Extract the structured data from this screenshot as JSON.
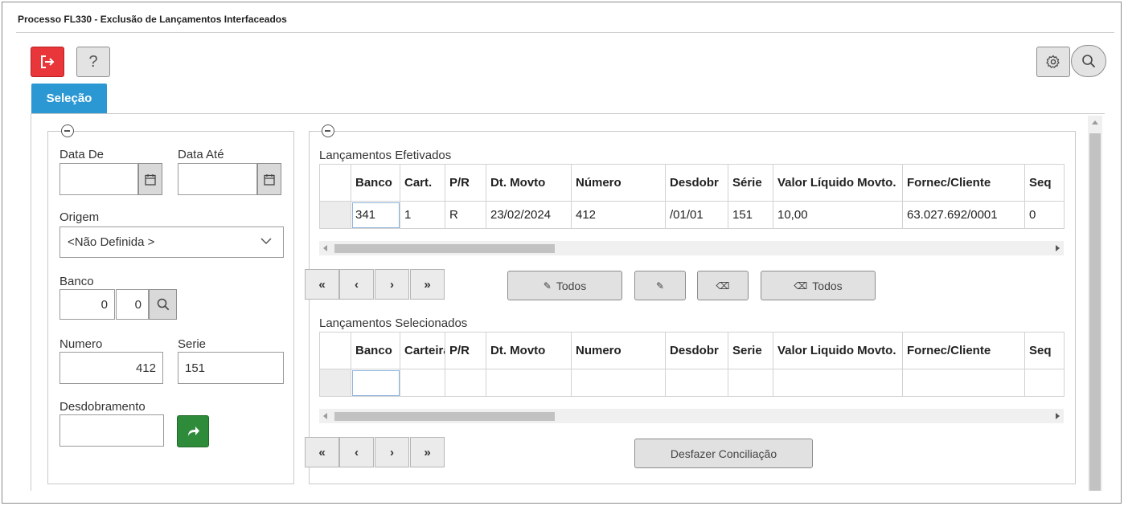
{
  "window": {
    "title": "Processo FL330 - Exclusão de Lançamentos Interfaceados"
  },
  "toolbar": {
    "help_label": "?"
  },
  "tabs": [
    {
      "label": "Seleção",
      "active": true
    }
  ],
  "colors": {
    "exit": "#e8363a",
    "tab_active": "#2b98d4",
    "go": "#2e8b3a"
  },
  "filters": {
    "data_de_label": "Data De",
    "data_de_value": "",
    "data_ate_label": "Data Até",
    "data_ate_value": "",
    "origem_label": "Origem",
    "origem_value": "<Não Definida >",
    "banco_label": "Banco",
    "banco_value1": "0",
    "banco_value2": "0",
    "numero_label": "Numero",
    "numero_value": "412",
    "serie_label": "Serie",
    "serie_value": "151",
    "desdobramento_label": "Desdobramento",
    "desdobramento_value": ""
  },
  "efetivados": {
    "title": "Lançamentos Efetivados",
    "columns": [
      "Banco",
      "Cart.",
      "P/R",
      "Dt. Movto",
      "Número",
      "Desdobr",
      "Série",
      "Valor Líquido Movto.",
      "Fornec/Cliente",
      "Seq"
    ],
    "rows": [
      [
        "341",
        "1",
        "R",
        "23/02/2024",
        "412",
        "/01/01",
        "151",
        "10,00",
        "63.027.692/0001",
        "0"
      ]
    ]
  },
  "nav": {
    "first": "«",
    "prev": "‹",
    "next": "›",
    "last": "»"
  },
  "actions": {
    "mark_all": "Todos",
    "unmark_all": "Todos"
  },
  "selecionados": {
    "title": "Lançamentos Selecionados",
    "columns": [
      "Banco",
      "Carteira",
      "P/R",
      "Dt. Movto",
      "Numero",
      "Desdobr",
      "Serie",
      "Valor Liquido Movto.",
      "Fornec/Cliente",
      "Seq"
    ]
  },
  "undo_button": "Desfazer Conciliação",
  "icons": {
    "exit": "logout-icon",
    "gear": "gear-icon",
    "search": "search-icon",
    "calendar": "calendar-icon",
    "chevron": "chevron-down-icon",
    "go": "share-arrow-icon",
    "marker": "highlighter-icon",
    "eraser": "eraser-icon",
    "collapse": "minus-circle-icon"
  }
}
